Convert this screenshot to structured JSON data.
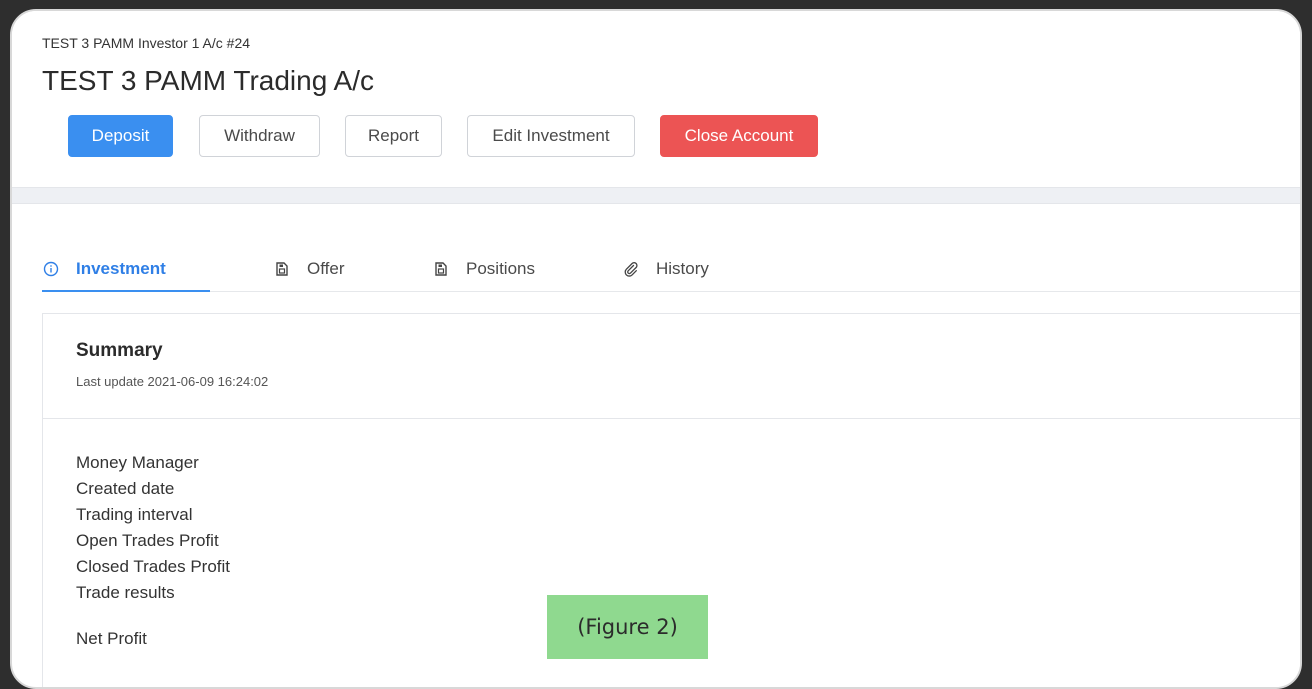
{
  "header": {
    "breadcrumb": "TEST 3 PAMM Investor 1 A/c #24",
    "title": "TEST 3 PAMM Trading A/c"
  },
  "toolbar": {
    "deposit": "Deposit",
    "withdraw": "Withdraw",
    "report": "Report",
    "edit_investment": "Edit Investment",
    "close_account": "Close Account"
  },
  "tabs": [
    {
      "label": "Investment",
      "icon": "info-icon",
      "active": true
    },
    {
      "label": "Offer",
      "icon": "document-icon",
      "active": false
    },
    {
      "label": "Positions",
      "icon": "document-icon",
      "active": false
    },
    {
      "label": "History",
      "icon": "paperclip-icon",
      "active": false
    }
  ],
  "summary": {
    "title": "Summary",
    "last_update": "Last update 2021-06-09 16:24:02",
    "rows": [
      "Money Manager",
      "Created date",
      "Trading interval",
      "Open Trades Profit",
      "Closed Trades Profit",
      "Trade results",
      "Net Profit"
    ]
  },
  "figure_label": "(Figure 2)",
  "colors": {
    "primary": "#3a8ff0",
    "danger": "#ec5454",
    "active_tab": "#2f7fe6",
    "figure_label_bg": "#8fd98f"
  }
}
